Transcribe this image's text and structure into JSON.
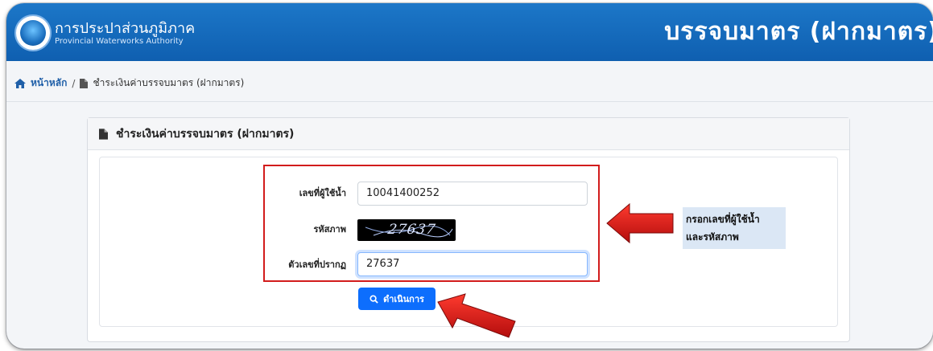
{
  "header": {
    "org_name_th": "การประปาส่วนภูมิภาค",
    "org_name_en": "Provincial Waterworks Authority",
    "page_heading": "บรรจบมาตร (ฝากมาตร)"
  },
  "breadcrumb": {
    "home": "หน้าหลัก",
    "separator": "/",
    "current": "ชำระเงินค่าบรรจบมาตร (ฝากมาตร)"
  },
  "card": {
    "title": "ชำระเงินค่าบรรจบมาตร (ฝากมาตร)"
  },
  "form": {
    "user_number_label": "เลขที่ผู้ใช้น้ำ",
    "user_number_value": "10041400252",
    "captcha_label": "รหัสภาพ",
    "captcha_text": "27637",
    "confirm_label": "ตัวเลขที่ปรากฏ",
    "confirm_value": "27637",
    "submit_label": "ดำเนินการ"
  },
  "annotation": {
    "line1": "กรอกเลขที่ผู้ใช้น้ำ",
    "line2": "และรหัสภาพ"
  },
  "colors": {
    "header_blue": "#1565c0",
    "button_blue": "#0d6efd",
    "highlight_red": "#d21c1c",
    "hint_bg": "#dbe7f5"
  },
  "icons": [
    "home-icon",
    "document-icon",
    "search-icon",
    "red-arrow-icon"
  ]
}
